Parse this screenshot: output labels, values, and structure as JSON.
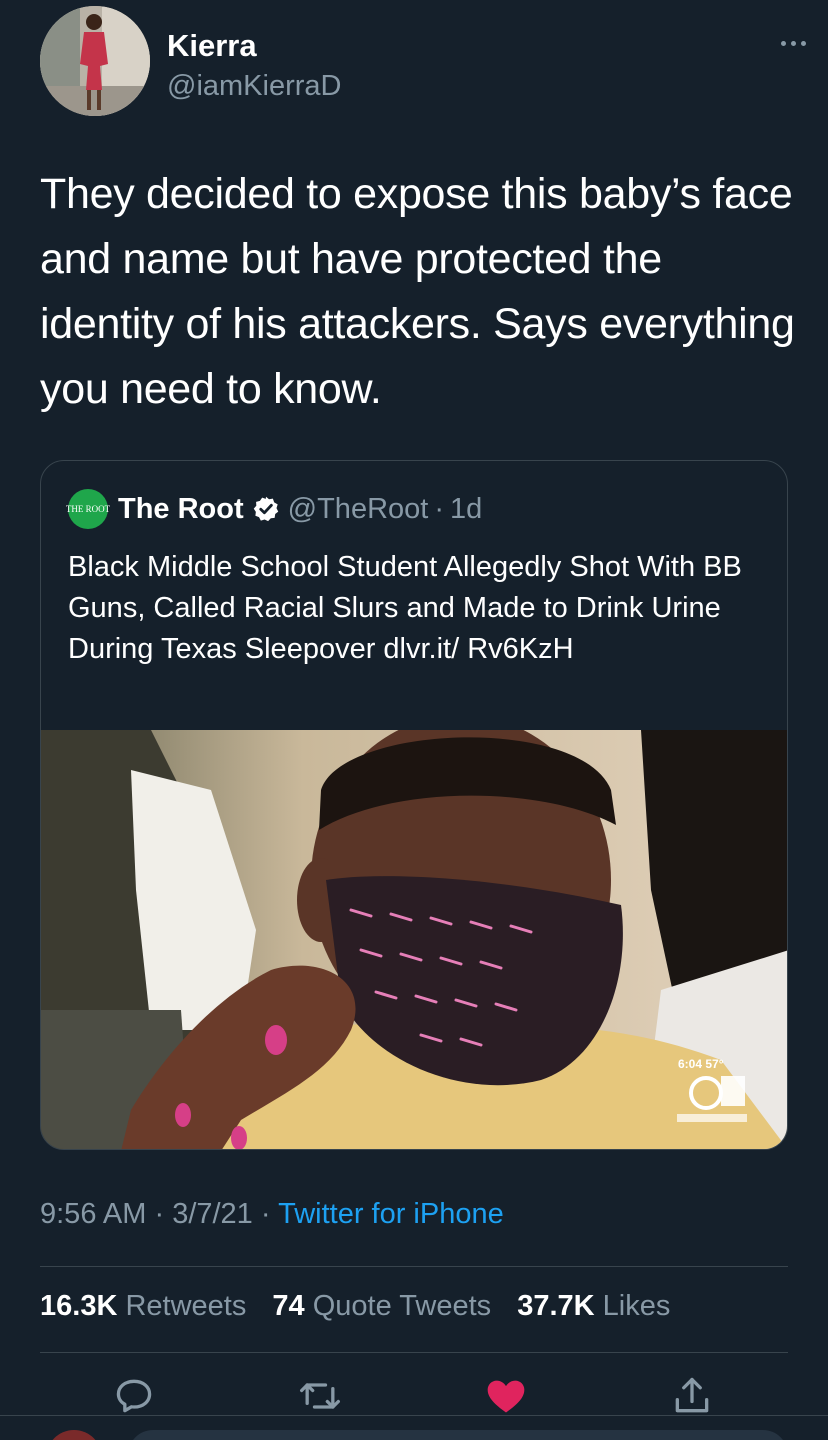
{
  "author": {
    "display_name": "Kierra",
    "handle": "@iamKierraD"
  },
  "tweet": {
    "text": "They decided to expose this baby’s face and name but have protected the identity of his attackers. Says everything you need to know."
  },
  "quoted_tweet": {
    "logo_text": "THE ROOT",
    "name": "The Root",
    "handle": "@TheRoot",
    "separator": "·",
    "time": "1d",
    "text": "Black Middle School Student Allegedly Shot With BB Guns, Called Racial Slurs and Made to Drink Urine During Texas Sleepover dlvr.it/ Rv6KzH",
    "image_overlay_time": "6:04  57°"
  },
  "meta": {
    "time": "9:56 AM",
    "sep1": " · ",
    "date": "3/7/21",
    "sep2": " · ",
    "client": "Twitter for iPhone"
  },
  "stats": {
    "retweets_count": "16.3K",
    "retweets_label": "Retweets",
    "quotes_count": "74",
    "quotes_label": "Quote Tweets",
    "likes_count": "37.7K",
    "likes_label": "Likes"
  },
  "icons": {
    "reply": "reply-icon",
    "retweet": "retweet-icon",
    "like": "heart-icon",
    "share": "share-icon",
    "more": "more-icon",
    "verified": "verified-badge-icon"
  },
  "colors": {
    "background": "#15202b",
    "secondary_text": "#8899a6",
    "link": "#1da1f2",
    "like_active": "#e0245e",
    "border": "#38444d"
  }
}
